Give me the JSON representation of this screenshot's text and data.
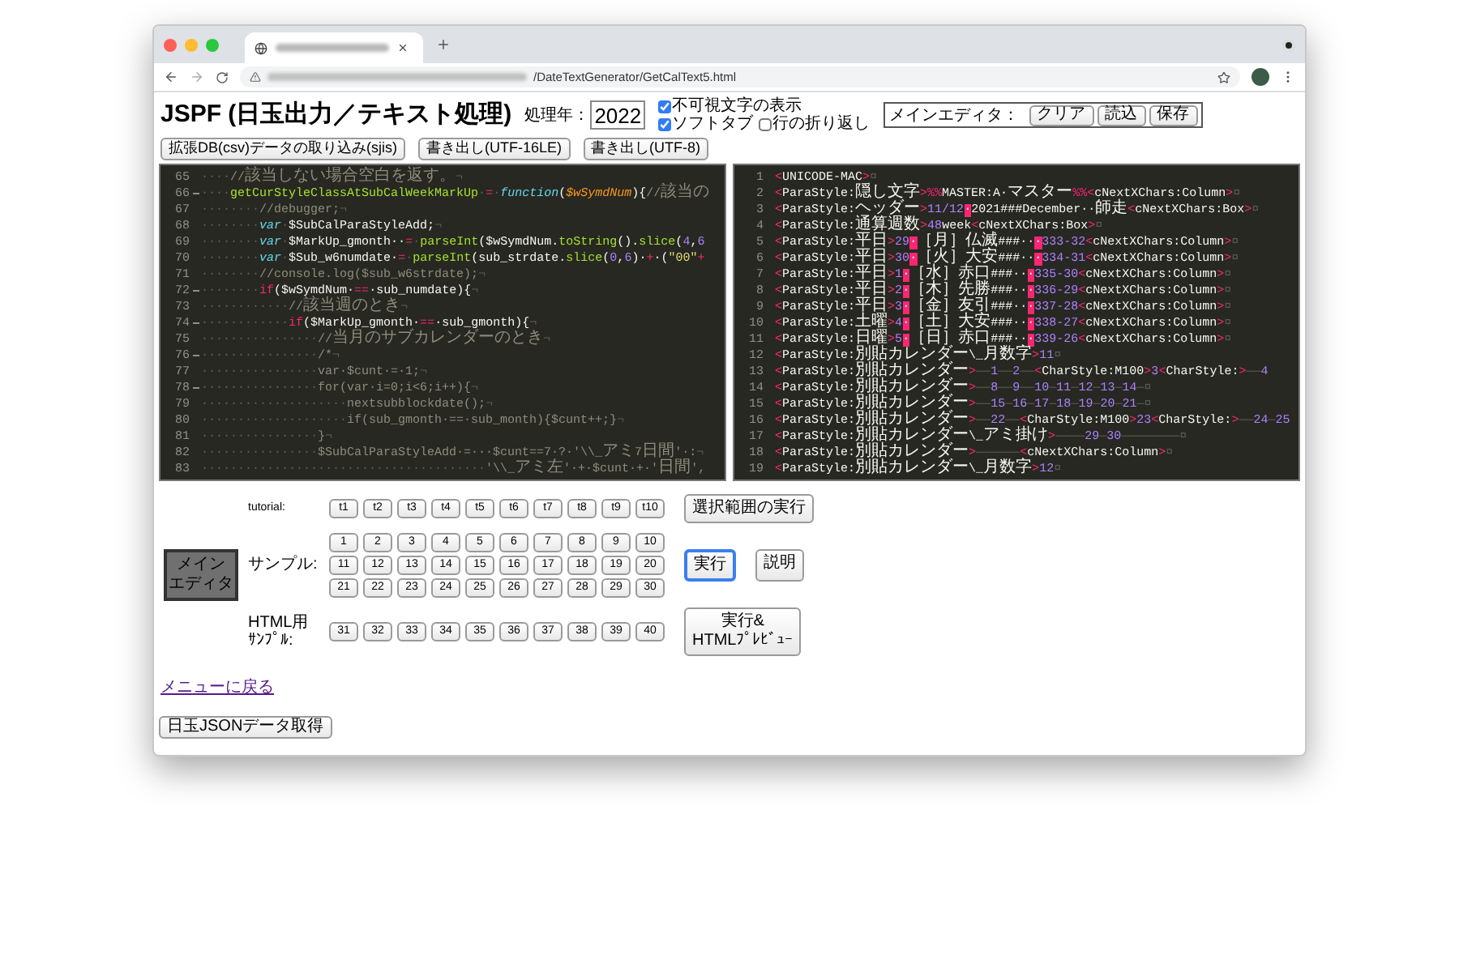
{
  "browser": {
    "url_path": "/DateTextGenerator/GetCalText5.html"
  },
  "header": {
    "title": "JSPF (日玉出力／テキスト処理)",
    "year_label": "処理年：",
    "year_value": "2022",
    "options": [
      {
        "label": "不可視文字の表示",
        "checked": true
      },
      {
        "label": "ソフトタブ",
        "checked": true
      },
      {
        "label": "行の折り返し",
        "checked": false
      }
    ],
    "editor_group": {
      "label": "メインエディタ：",
      "buttons": [
        "クリア",
        "読込",
        "保存"
      ]
    },
    "buttons": [
      "拡張DB(csv)データの取り込み(sjis)",
      "書き出し(UTF-16LE)",
      "書き出し(UTF-8)"
    ]
  },
  "code_editor": {
    "lines": [
      {
        "number": "65",
        "fold": false,
        "segments": [
          {
            "kind": "ws",
            "text": "····"
          },
          {
            "kind": "comment",
            "text": "//該当しない場合空白を返す。"
          },
          {
            "kind": "ws",
            "text": "¬"
          }
        ]
      },
      {
        "number": "66",
        "fold": true,
        "segments": [
          {
            "kind": "ws",
            "text": "····"
          },
          {
            "kind": "fn",
            "text": "getCurStyleClassAtSubCalWeekMarkUp"
          },
          {
            "kind": "ws",
            "text": "·"
          },
          {
            "kind": "op",
            "text": "="
          },
          {
            "kind": "ws",
            "text": "·"
          },
          {
            "kind": "kw",
            "text": "function"
          },
          {
            "kind": "text",
            "text": "("
          },
          {
            "kind": "param",
            "text": "$wSymdNum"
          },
          {
            "kind": "text",
            "text": "){"
          },
          {
            "kind": "comment",
            "text": "//該当の"
          }
        ]
      },
      {
        "number": "67",
        "fold": false,
        "segments": [
          {
            "kind": "ws",
            "text": "········"
          },
          {
            "kind": "comment",
            "text": "//debugger;"
          },
          {
            "kind": "ws",
            "text": "¬"
          }
        ]
      },
      {
        "number": "68",
        "fold": false,
        "segments": [
          {
            "kind": "ws",
            "text": "········"
          },
          {
            "kind": "kw",
            "text": "var"
          },
          {
            "kind": "ws",
            "text": "·"
          },
          {
            "kind": "text",
            "text": "$SubCalParaStyleAdd;"
          },
          {
            "kind": "ws",
            "text": "¬"
          }
        ]
      },
      {
        "number": "69",
        "fold": false,
        "segments": [
          {
            "kind": "ws",
            "text": "········"
          },
          {
            "kind": "kw",
            "text": "var"
          },
          {
            "kind": "ws",
            "text": "·"
          },
          {
            "kind": "text",
            "text": "$MarkUp_gmonth··"
          },
          {
            "kind": "op",
            "text": "="
          },
          {
            "kind": "ws",
            "text": "·"
          },
          {
            "kind": "fn",
            "text": "parseInt"
          },
          {
            "kind": "text",
            "text": "($wSymdNum."
          },
          {
            "kind": "fn",
            "text": "toString"
          },
          {
            "kind": "text",
            "text": "()."
          },
          {
            "kind": "fn",
            "text": "slice"
          },
          {
            "kind": "text",
            "text": "("
          },
          {
            "kind": "num",
            "text": "4"
          },
          {
            "kind": "text",
            "text": ","
          },
          {
            "kind": "num",
            "text": "6"
          }
        ]
      },
      {
        "number": "70",
        "fold": false,
        "segments": [
          {
            "kind": "ws",
            "text": "········"
          },
          {
            "kind": "kw",
            "text": "var"
          },
          {
            "kind": "ws",
            "text": "·"
          },
          {
            "kind": "text",
            "text": "$Sub_w6numdate·"
          },
          {
            "kind": "op",
            "text": "="
          },
          {
            "kind": "ws",
            "text": "·"
          },
          {
            "kind": "fn",
            "text": "parseInt"
          },
          {
            "kind": "text",
            "text": "(sub_strdate."
          },
          {
            "kind": "fn",
            "text": "slice"
          },
          {
            "kind": "text",
            "text": "("
          },
          {
            "kind": "num",
            "text": "0"
          },
          {
            "kind": "text",
            "text": ","
          },
          {
            "kind": "num",
            "text": "6"
          },
          {
            "kind": "text",
            "text": ")·"
          },
          {
            "kind": "op",
            "text": "+"
          },
          {
            "kind": "text",
            "text": "·("
          },
          {
            "kind": "str",
            "text": "\"00\""
          },
          {
            "kind": "op",
            "text": "+"
          }
        ]
      },
      {
        "number": "71",
        "fold": false,
        "segments": [
          {
            "kind": "ws",
            "text": "········"
          },
          {
            "kind": "comment",
            "text": "//console.log($sub_w6strdate);"
          },
          {
            "kind": "ws",
            "text": "¬"
          }
        ]
      },
      {
        "number": "72",
        "fold": true,
        "segments": [
          {
            "kind": "ws",
            "text": "········"
          },
          {
            "kind": "op",
            "text": "if"
          },
          {
            "kind": "text",
            "text": "($wSymdNum·"
          },
          {
            "kind": "op",
            "text": "=="
          },
          {
            "kind": "text",
            "text": "·sub_numdate){"
          },
          {
            "kind": "ws",
            "text": "¬"
          }
        ]
      },
      {
        "number": "73",
        "fold": false,
        "segments": [
          {
            "kind": "ws",
            "text": "············"
          },
          {
            "kind": "comment",
            "text": "//該当週のとき"
          },
          {
            "kind": "ws",
            "text": "¬"
          }
        ]
      },
      {
        "number": "74",
        "fold": true,
        "segments": [
          {
            "kind": "ws",
            "text": "············"
          },
          {
            "kind": "op",
            "text": "if"
          },
          {
            "kind": "text",
            "text": "($MarkUp_gmonth·"
          },
          {
            "kind": "op",
            "text": "=="
          },
          {
            "kind": "text",
            "text": "·sub_gmonth){"
          },
          {
            "kind": "ws",
            "text": "¬"
          }
        ]
      },
      {
        "number": "75",
        "fold": false,
        "segments": [
          {
            "kind": "ws",
            "text": "················"
          },
          {
            "kind": "comment",
            "text": "//当月のサブカレンダーのとき"
          },
          {
            "kind": "ws",
            "text": "¬"
          }
        ]
      },
      {
        "number": "76",
        "fold": true,
        "segments": [
          {
            "kind": "ws",
            "text": "················"
          },
          {
            "kind": "comment",
            "text": "/*"
          },
          {
            "kind": "ws",
            "text": "¬"
          }
        ]
      },
      {
        "number": "77",
        "fold": false,
        "segments": [
          {
            "kind": "ws",
            "text": "················"
          },
          {
            "kind": "comment",
            "text": "var·$cunt·=·1;"
          },
          {
            "kind": "ws",
            "text": "¬"
          }
        ]
      },
      {
        "number": "78",
        "fold": true,
        "segments": [
          {
            "kind": "ws",
            "text": "················"
          },
          {
            "kind": "comment",
            "text": "for(var·i=0;i<6;i++){"
          },
          {
            "kind": "ws",
            "text": "¬"
          }
        ]
      },
      {
        "number": "79",
        "fold": false,
        "segments": [
          {
            "kind": "ws",
            "text": "····················"
          },
          {
            "kind": "comment",
            "text": "nextsubblockdate();"
          },
          {
            "kind": "ws",
            "text": "¬"
          }
        ]
      },
      {
        "number": "80",
        "fold": false,
        "segments": [
          {
            "kind": "ws",
            "text": "····················"
          },
          {
            "kind": "comment",
            "text": "if(sub_gmonth·==·sub_month){$cunt++;}"
          },
          {
            "kind": "ws",
            "text": "¬"
          }
        ]
      },
      {
        "number": "81",
        "fold": false,
        "segments": [
          {
            "kind": "ws",
            "text": "················"
          },
          {
            "kind": "comment",
            "text": "}"
          },
          {
            "kind": "ws",
            "text": "¬"
          }
        ]
      },
      {
        "number": "82",
        "fold": false,
        "segments": [
          {
            "kind": "ws",
            "text": "················"
          },
          {
            "kind": "comment",
            "text": "$SubCalParaStyleAdd·=···$cunt==7·?·'\\\\_アミ7日間'·:"
          },
          {
            "kind": "ws",
            "text": "¬"
          }
        ]
      },
      {
        "number": "83",
        "fold": false,
        "segments": [
          {
            "kind": "ws",
            "text": "·······································"
          },
          {
            "kind": "comment",
            "text": "'\\\\_アミ左'·+·$cunt·+·'日間',"
          }
        ]
      }
    ]
  },
  "output_editor": {
    "lines": [
      {
        "number": "1",
        "segments": [
          {
            "kind": "tag",
            "text": "<"
          },
          {
            "kind": "text",
            "text": "UNICODE-MAC"
          },
          {
            "kind": "tag",
            "text": ">"
          },
          {
            "kind": "ws",
            "text": "¤"
          }
        ]
      },
      {
        "number": "2",
        "segments": [
          {
            "kind": "tag",
            "text": "<"
          },
          {
            "kind": "text",
            "text": "ParaStyle:隠し文字"
          },
          {
            "kind": "tag",
            "text": ">%%"
          },
          {
            "kind": "text",
            "text": "MASTER:A·マスター"
          },
          {
            "kind": "tag",
            "text": "%%<"
          },
          {
            "kind": "text",
            "text": "cNextXChars:Column"
          },
          {
            "kind": "tag",
            "text": ">"
          },
          {
            "kind": "ws",
            "text": "¤"
          }
        ]
      },
      {
        "number": "3",
        "segments": [
          {
            "kind": "tag",
            "text": "<"
          },
          {
            "kind": "text",
            "text": "ParaStyle:ヘッダー"
          },
          {
            "kind": "tag",
            "text": ">"
          },
          {
            "kind": "num",
            "text": "11/12"
          },
          {
            "kind": "mark",
            "text": "·"
          },
          {
            "kind": "text",
            "text": "2021###December··師走"
          },
          {
            "kind": "tag",
            "text": "<"
          },
          {
            "kind": "text",
            "text": "cNextXChars:Box"
          },
          {
            "kind": "tag",
            "text": ">"
          },
          {
            "kind": "ws",
            "text": "¤"
          }
        ]
      },
      {
        "number": "4",
        "segments": [
          {
            "kind": "tag",
            "text": "<"
          },
          {
            "kind": "text",
            "text": "ParaStyle:通算週数"
          },
          {
            "kind": "tag",
            "text": ">"
          },
          {
            "kind": "num",
            "text": "48"
          },
          {
            "kind": "text",
            "text": "week"
          },
          {
            "kind": "tag",
            "text": "<"
          },
          {
            "kind": "text",
            "text": "cNextXChars:Box"
          },
          {
            "kind": "tag",
            "text": ">"
          },
          {
            "kind": "ws",
            "text": "¤"
          }
        ]
      },
      {
        "number": "5",
        "segments": [
          {
            "kind": "tag",
            "text": "<"
          },
          {
            "kind": "text",
            "text": "ParaStyle:平日"
          },
          {
            "kind": "tag",
            "text": ">"
          },
          {
            "kind": "num",
            "text": "29"
          },
          {
            "kind": "mark",
            "text": "·"
          },
          {
            "kind": "text",
            "text": "［月］仏滅###··"
          },
          {
            "kind": "mark",
            "text": "·"
          },
          {
            "kind": "num",
            "text": "333-32"
          },
          {
            "kind": "tag",
            "text": "<"
          },
          {
            "kind": "text",
            "text": "cNextXChars:Column"
          },
          {
            "kind": "tag",
            "text": ">"
          },
          {
            "kind": "ws",
            "text": "¤"
          }
        ]
      },
      {
        "number": "6",
        "segments": [
          {
            "kind": "tag",
            "text": "<"
          },
          {
            "kind": "text",
            "text": "ParaStyle:平日"
          },
          {
            "kind": "tag",
            "text": ">"
          },
          {
            "kind": "num",
            "text": "30"
          },
          {
            "kind": "mark",
            "text": "·"
          },
          {
            "kind": "text",
            "text": "［火］大安###··"
          },
          {
            "kind": "mark",
            "text": "·"
          },
          {
            "kind": "num",
            "text": "334-31"
          },
          {
            "kind": "tag",
            "text": "<"
          },
          {
            "kind": "text",
            "text": "cNextXChars:Column"
          },
          {
            "kind": "tag",
            "text": ">"
          },
          {
            "kind": "ws",
            "text": "¤"
          }
        ]
      },
      {
        "number": "7",
        "segments": [
          {
            "kind": "tag",
            "text": "<"
          },
          {
            "kind": "text",
            "text": "ParaStyle:平日"
          },
          {
            "kind": "tag",
            "text": ">"
          },
          {
            "kind": "num",
            "text": "1"
          },
          {
            "kind": "mark",
            "text": "·"
          },
          {
            "kind": "text",
            "text": "［水］赤口###··"
          },
          {
            "kind": "mark",
            "text": "·"
          },
          {
            "kind": "num",
            "text": "335-30"
          },
          {
            "kind": "tag",
            "text": "<"
          },
          {
            "kind": "text",
            "text": "cNextXChars:Column"
          },
          {
            "kind": "tag",
            "text": ">"
          },
          {
            "kind": "ws",
            "text": "¤"
          }
        ]
      },
      {
        "number": "8",
        "segments": [
          {
            "kind": "tag",
            "text": "<"
          },
          {
            "kind": "text",
            "text": "ParaStyle:平日"
          },
          {
            "kind": "tag",
            "text": ">"
          },
          {
            "kind": "num",
            "text": "2"
          },
          {
            "kind": "mark",
            "text": "·"
          },
          {
            "kind": "text",
            "text": "［木］先勝###··"
          },
          {
            "kind": "mark",
            "text": "·"
          },
          {
            "kind": "num",
            "text": "336-29"
          },
          {
            "kind": "tag",
            "text": "<"
          },
          {
            "kind": "text",
            "text": "cNextXChars:Column"
          },
          {
            "kind": "tag",
            "text": ">"
          },
          {
            "kind": "ws",
            "text": "¤"
          }
        ]
      },
      {
        "number": "9",
        "segments": [
          {
            "kind": "tag",
            "text": "<"
          },
          {
            "kind": "text",
            "text": "ParaStyle:平日"
          },
          {
            "kind": "tag",
            "text": ">"
          },
          {
            "kind": "num",
            "text": "3"
          },
          {
            "kind": "mark",
            "text": "·"
          },
          {
            "kind": "text",
            "text": "［金］友引###··"
          },
          {
            "kind": "mark",
            "text": "·"
          },
          {
            "kind": "num",
            "text": "337-28"
          },
          {
            "kind": "tag",
            "text": "<"
          },
          {
            "kind": "text",
            "text": "cNextXChars:Column"
          },
          {
            "kind": "tag",
            "text": ">"
          },
          {
            "kind": "ws",
            "text": "¤"
          }
        ]
      },
      {
        "number": "10",
        "segments": [
          {
            "kind": "tag",
            "text": "<"
          },
          {
            "kind": "text",
            "text": "ParaStyle:土曜"
          },
          {
            "kind": "tag",
            "text": ">"
          },
          {
            "kind": "num",
            "text": "4"
          },
          {
            "kind": "mark",
            "text": "·"
          },
          {
            "kind": "text",
            "text": "［土］大安###··"
          },
          {
            "kind": "mark",
            "text": "·"
          },
          {
            "kind": "num",
            "text": "338-27"
          },
          {
            "kind": "tag",
            "text": "<"
          },
          {
            "kind": "text",
            "text": "cNextXChars:Column"
          },
          {
            "kind": "tag",
            "text": ">"
          },
          {
            "kind": "ws",
            "text": "¤"
          }
        ]
      },
      {
        "number": "11",
        "segments": [
          {
            "kind": "tag",
            "text": "<"
          },
          {
            "kind": "text",
            "text": "ParaStyle:日曜"
          },
          {
            "kind": "tag",
            "text": ">"
          },
          {
            "kind": "num",
            "text": "5"
          },
          {
            "kind": "mark",
            "text": "·"
          },
          {
            "kind": "text",
            "text": "［日］赤口###··"
          },
          {
            "kind": "mark",
            "text": "·"
          },
          {
            "kind": "num",
            "text": "339-26"
          },
          {
            "kind": "tag",
            "text": "<"
          },
          {
            "kind": "text",
            "text": "cNextXChars:Column"
          },
          {
            "kind": "tag",
            "text": ">"
          },
          {
            "kind": "ws",
            "text": "¤"
          }
        ]
      },
      {
        "number": "12",
        "segments": [
          {
            "kind": "tag",
            "text": "<"
          },
          {
            "kind": "text",
            "text": "ParaStyle:別貼カレンダー\\_月数字"
          },
          {
            "kind": "tag",
            "text": ">"
          },
          {
            "kind": "num",
            "text": "11"
          },
          {
            "kind": "ws",
            "text": "¤"
          }
        ]
      },
      {
        "number": "13",
        "segments": [
          {
            "kind": "tag",
            "text": "<"
          },
          {
            "kind": "text",
            "text": "ParaStyle:別貼カレンダー"
          },
          {
            "kind": "tag",
            "text": ">"
          },
          {
            "kind": "ws",
            "text": "——"
          },
          {
            "kind": "num",
            "text": "1"
          },
          {
            "kind": "ws",
            "text": "——"
          },
          {
            "kind": "num",
            "text": "2"
          },
          {
            "kind": "ws",
            "text": "——"
          },
          {
            "kind": "tag",
            "text": "<"
          },
          {
            "kind": "text",
            "text": "CharStyle:M100"
          },
          {
            "kind": "tag",
            "text": ">"
          },
          {
            "kind": "num",
            "text": "3"
          },
          {
            "kind": "tag",
            "text": "<"
          },
          {
            "kind": "text",
            "text": "CharStyle:"
          },
          {
            "kind": "tag",
            "text": ">"
          },
          {
            "kind": "ws",
            "text": "——"
          },
          {
            "kind": "num",
            "text": "4"
          }
        ]
      },
      {
        "number": "14",
        "segments": [
          {
            "kind": "tag",
            "text": "<"
          },
          {
            "kind": "text",
            "text": "ParaStyle:別貼カレンダー"
          },
          {
            "kind": "tag",
            "text": ">"
          },
          {
            "kind": "ws",
            "text": "——"
          },
          {
            "kind": "num",
            "text": "8"
          },
          {
            "kind": "ws",
            "text": "——"
          },
          {
            "kind": "num",
            "text": "9"
          },
          {
            "kind": "ws",
            "text": "——"
          },
          {
            "kind": "num",
            "text": "10"
          },
          {
            "kind": "ws",
            "text": "—"
          },
          {
            "kind": "num",
            "text": "11"
          },
          {
            "kind": "ws",
            "text": "—"
          },
          {
            "kind": "num",
            "text": "12"
          },
          {
            "kind": "ws",
            "text": "—"
          },
          {
            "kind": "num",
            "text": "13"
          },
          {
            "kind": "ws",
            "text": "—"
          },
          {
            "kind": "num",
            "text": "14"
          },
          {
            "kind": "ws",
            "text": "—¤"
          }
        ]
      },
      {
        "number": "15",
        "segments": [
          {
            "kind": "tag",
            "text": "<"
          },
          {
            "kind": "text",
            "text": "ParaStyle:別貼カレンダー"
          },
          {
            "kind": "tag",
            "text": ">"
          },
          {
            "kind": "ws",
            "text": "——"
          },
          {
            "kind": "num",
            "text": "15"
          },
          {
            "kind": "ws",
            "text": "—"
          },
          {
            "kind": "num",
            "text": "16"
          },
          {
            "kind": "ws",
            "text": "—"
          },
          {
            "kind": "num",
            "text": "17"
          },
          {
            "kind": "ws",
            "text": "—"
          },
          {
            "kind": "num",
            "text": "18"
          },
          {
            "kind": "ws",
            "text": "—"
          },
          {
            "kind": "num",
            "text": "19"
          },
          {
            "kind": "ws",
            "text": "—"
          },
          {
            "kind": "num",
            "text": "20"
          },
          {
            "kind": "ws",
            "text": "—"
          },
          {
            "kind": "num",
            "text": "21"
          },
          {
            "kind": "ws",
            "text": "—¤"
          }
        ]
      },
      {
        "number": "16",
        "segments": [
          {
            "kind": "tag",
            "text": "<"
          },
          {
            "kind": "text",
            "text": "ParaStyle:別貼カレンダー"
          },
          {
            "kind": "tag",
            "text": ">"
          },
          {
            "kind": "ws",
            "text": "——"
          },
          {
            "kind": "num",
            "text": "22"
          },
          {
            "kind": "ws",
            "text": "——"
          },
          {
            "kind": "tag",
            "text": "<"
          },
          {
            "kind": "text",
            "text": "CharStyle:M100"
          },
          {
            "kind": "tag",
            "text": ">"
          },
          {
            "kind": "num",
            "text": "23"
          },
          {
            "kind": "tag",
            "text": "<"
          },
          {
            "kind": "text",
            "text": "CharStyle:"
          },
          {
            "kind": "tag",
            "text": ">"
          },
          {
            "kind": "ws",
            "text": "——"
          },
          {
            "kind": "num",
            "text": "24"
          },
          {
            "kind": "ws",
            "text": "—"
          },
          {
            "kind": "num",
            "text": "25"
          }
        ]
      },
      {
        "number": "17",
        "segments": [
          {
            "kind": "tag",
            "text": "<"
          },
          {
            "kind": "text",
            "text": "ParaStyle:別貼カレンダー\\_アミ掛け"
          },
          {
            "kind": "tag",
            "text": ">"
          },
          {
            "kind": "ws",
            "text": "————"
          },
          {
            "kind": "num",
            "text": "29"
          },
          {
            "kind": "ws",
            "text": "—"
          },
          {
            "kind": "num",
            "text": "30"
          },
          {
            "kind": "ws",
            "text": "————————¤"
          }
        ]
      },
      {
        "number": "18",
        "segments": [
          {
            "kind": "tag",
            "text": "<"
          },
          {
            "kind": "text",
            "text": "ParaStyle:別貼カレンダー"
          },
          {
            "kind": "tag",
            "text": ">"
          },
          {
            "kind": "ws",
            "text": "——————"
          },
          {
            "kind": "tag",
            "text": "<"
          },
          {
            "kind": "text",
            "text": "cNextXChars:Column"
          },
          {
            "kind": "tag",
            "text": ">"
          },
          {
            "kind": "ws",
            "text": "¤"
          }
        ]
      },
      {
        "number": "19",
        "segments": [
          {
            "kind": "tag",
            "text": "<"
          },
          {
            "kind": "text",
            "text": "ParaStyle:別貼カレンダー\\_月数字"
          },
          {
            "kind": "tag",
            "text": ">"
          },
          {
            "kind": "num",
            "text": "12"
          },
          {
            "kind": "ws",
            "text": "¤"
          }
        ]
      }
    ]
  },
  "controls": {
    "mode_button": {
      "label": [
        "メイン",
        "エディタ"
      ],
      "pressed": true
    },
    "rows": [
      {
        "label": [
          "tutorial:"
        ],
        "buttons": [
          "t1",
          "t2",
          "t3",
          "t4",
          "t5",
          "t6",
          "t7",
          "t8",
          "t9",
          "t10"
        ],
        "actions": [
          {
            "label": [
              "選択範囲の実行"
            ],
            "focused": false
          }
        ]
      },
      {
        "label": [
          "サンプル:"
        ],
        "buttons": [
          "1",
          "2",
          "3",
          "4",
          "5",
          "6",
          "7",
          "8",
          "9",
          "10",
          "11",
          "12",
          "13",
          "14",
          "15",
          "16",
          "17",
          "18",
          "19",
          "20",
          "21",
          "22",
          "23",
          "24",
          "25",
          "26",
          "27",
          "28",
          "29",
          "30"
        ],
        "actions": [
          {
            "label": [
              "実行"
            ],
            "focused": true
          },
          {
            "label": [
              "説明"
            ],
            "focused": false
          }
        ]
      },
      {
        "label": [
          "HTML用",
          "ｻﾝﾌﾟﾙ:"
        ],
        "buttons": [
          "31",
          "32",
          "33",
          "34",
          "35",
          "36",
          "37",
          "38",
          "39",
          "40"
        ],
        "actions": [
          {
            "label": [
              "実行&",
              "HTMLﾌﾟﾚﾋﾞｭｰ"
            ],
            "focused": false
          }
        ]
      }
    ]
  },
  "back_link": "メニューに戻る",
  "json_button": "日玉JSONデータ取得"
}
